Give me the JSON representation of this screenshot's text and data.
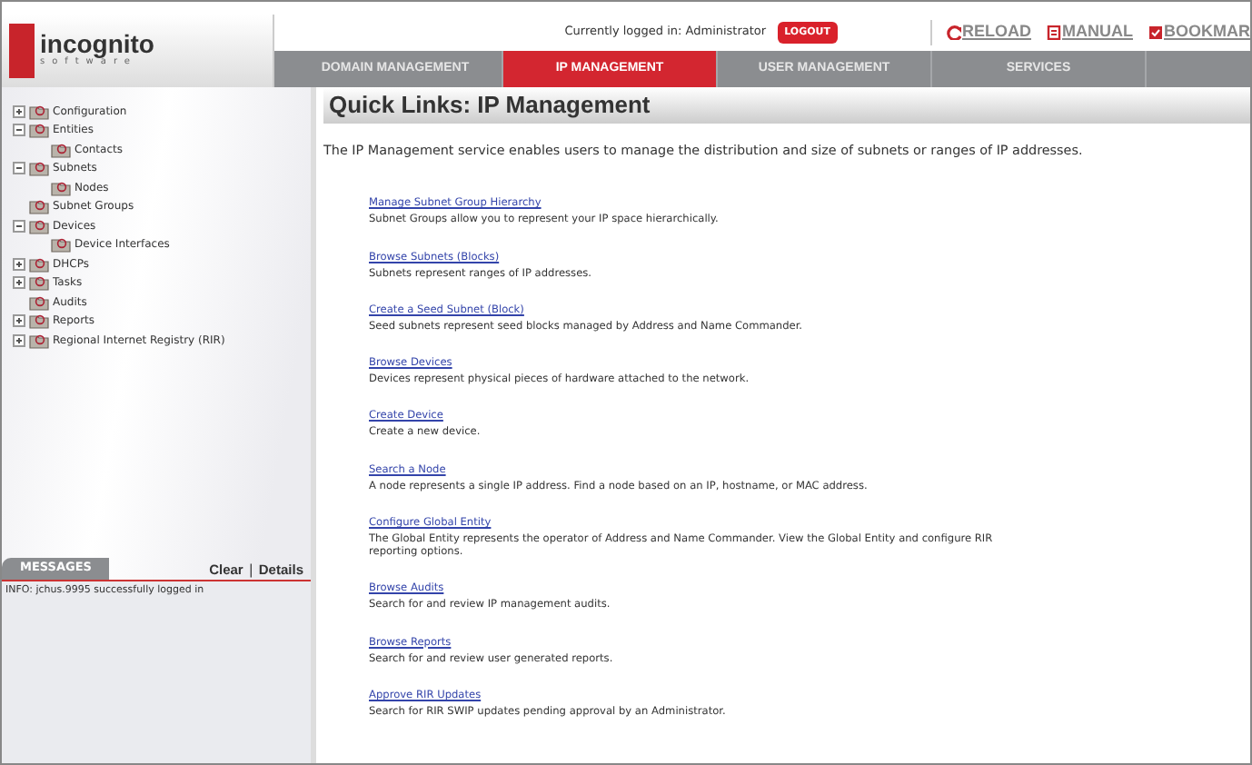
{
  "header": {
    "logo": "incognito",
    "logo_sub": "software",
    "login_text": "Currently logged in: Administrator",
    "logout": "LOGOUT",
    "tools": [
      {
        "label": "RELOAD"
      },
      {
        "label": "MANUAL"
      },
      {
        "label": "BOOKMAR"
      }
    ]
  },
  "tabs": [
    {
      "label": "DOMAIN MANAGEMENT",
      "selected": false
    },
    {
      "label": "IP MANAGEMENT",
      "selected": true
    },
    {
      "label": "USER MANAGEMENT",
      "selected": false
    },
    {
      "label": "SERVICES",
      "selected": false
    }
  ],
  "tree": [
    {
      "label": "Configuration",
      "expanded": false
    },
    {
      "label": "Entities",
      "expanded": true,
      "children": [
        {
          "label": "Contacts"
        }
      ]
    },
    {
      "label": "Subnets",
      "expanded": true,
      "children": [
        {
          "label": "Nodes"
        }
      ]
    },
    {
      "label": "Subnet Groups"
    },
    {
      "label": "Devices",
      "expanded": true,
      "children": [
        {
          "label": "Device Interfaces"
        }
      ]
    },
    {
      "label": "DHCPs",
      "expanded": false
    },
    {
      "label": "Tasks",
      "expanded": false
    },
    {
      "label": "Audits"
    },
    {
      "label": "Reports",
      "expanded": false
    },
    {
      "label": "Regional Internet Registry (RIR)",
      "expanded": false
    }
  ],
  "messages": {
    "title": "MESSAGES",
    "clear": "Clear",
    "separator": "|",
    "details": "Details",
    "lines": [
      "INFO: jchus.9995 successfully logged in"
    ]
  },
  "main": {
    "title": "Quick Links: IP Management",
    "intro": "The IP Management service enables users to manage the distribution and size of subnets or ranges of IP addresses.",
    "links": [
      {
        "link": "Manage Subnet Group Hierarchy",
        "text": "Subnet Groups allow you to represent your IP space hierarchically."
      },
      {
        "link": "Browse Subnets (Blocks)",
        "text": "Subnets represent ranges of IP addresses."
      },
      {
        "link": "Create a Seed Subnet (Block)",
        "text": "Seed subnets represent seed blocks managed by Address and Name Commander."
      },
      {
        "link": "Browse Devices",
        "text": "Devices represent physical pieces of hardware attached to the network."
      },
      {
        "link": "Create Device",
        "text": "Create a new device."
      },
      {
        "link": "Search a Node",
        "text": "A node represents a single IP address. Find a node based on an IP, hostname, or MAC address."
      },
      {
        "link": "Configure Global Entity",
        "text": "The Global Entity represents the operator of Address and Name Commander. View the Global Entity and configure RIR reporting options."
      },
      {
        "link": "Browse Audits",
        "text": "Search for and review IP management audits."
      },
      {
        "link": "Browse Reports",
        "text": "Search for and review user generated reports."
      },
      {
        "link": "Approve RIR Updates",
        "text": "Search for RIR SWIP updates pending approval by an Administrator."
      }
    ]
  }
}
